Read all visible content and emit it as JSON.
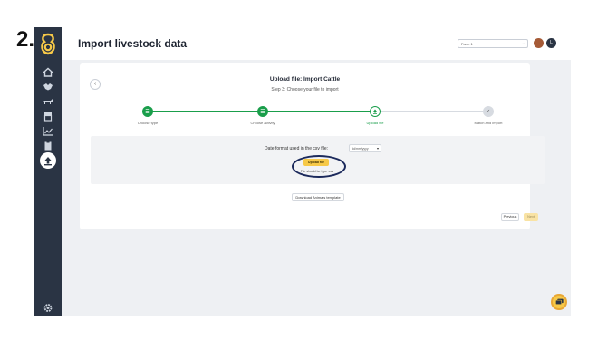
{
  "annotation": {
    "step_number": "2."
  },
  "sidebar": {
    "items": [
      {
        "icon": "home-icon"
      },
      {
        "icon": "handshake-icon"
      },
      {
        "icon": "cow-icon"
      },
      {
        "icon": "archive-icon"
      },
      {
        "icon": "chart-icon"
      },
      {
        "icon": "clipboard-icon"
      },
      {
        "icon": "upload-icon",
        "active": true
      }
    ],
    "settings_icon": "gear-icon"
  },
  "header": {
    "title": "Import livestock data",
    "farm_select": "Farm 1",
    "user_initial": "L"
  },
  "card": {
    "title": "Upload file: Import Cattle",
    "subtitle": "Step 3: Choose your file to import",
    "steps": [
      {
        "label": "Choose type",
        "status": "done"
      },
      {
        "label": "Choose activity",
        "status": "done"
      },
      {
        "label": "Upload file",
        "status": "current"
      },
      {
        "label": "Match and import",
        "status": "pending"
      }
    ],
    "date_format_label": "Date format used in the csv file:",
    "date_format_value": "dd/mm/yyyy",
    "upload_button": "Upload file",
    "file_hint": "File should be type .csv",
    "download_template": "Download Animals template",
    "previous": "Previous",
    "next": "Next"
  },
  "colors": {
    "sidebar_bg": "#2a3444",
    "accent_green": "#1a9e4b",
    "accent_yellow": "#f7c948",
    "annotation_oval": "#1c2a5c"
  }
}
